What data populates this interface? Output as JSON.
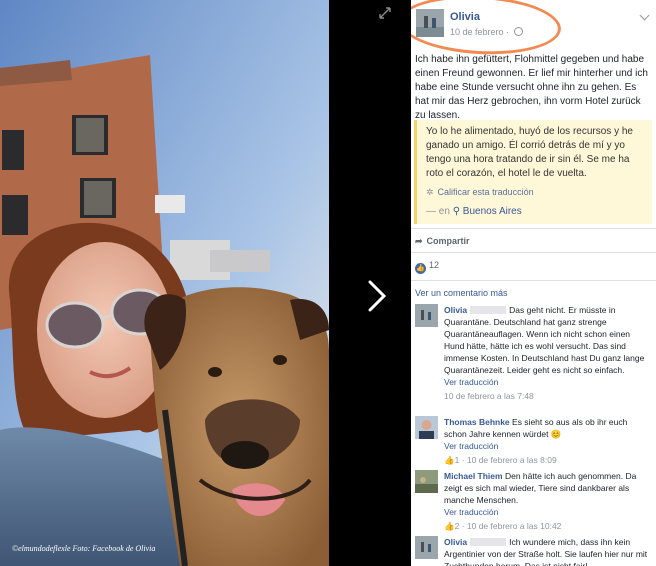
{
  "photo": {
    "watermark": "©elmundodeflexle Foto: Facebook de Olivia"
  },
  "navigation": {
    "next_icon": "chevron-right-icon",
    "expand_icon": "expand-arrows-icon"
  },
  "post": {
    "author": "Olivia",
    "date": "10 de febrero",
    "date_separator": " · ",
    "text": "Ich habe ihn gefüttert, Flohmittel gegeben und habe einen Freund gewonnen. Er lief mir hinterher und ich habe eine Stunde versucht ohne ihn zu gehen. Es hat mir das Herz gebrochen, ihn vorm Hotel zurück zu lassen.",
    "translation": "Yo lo he alimentado, huyó de los recursos y he ganado un amigo. Él corrió detrás de mí y yo tengo una hora tratando de ir sin él. Se me ha roto el corazón, el hotel le de vuelta.",
    "rate_translation": "Calificar esta traducción",
    "location_prefix": "— en",
    "location": "Buenos Aires",
    "share": "Compartir",
    "likes": "12",
    "accent_color": "#385898",
    "highlight_color": "#f28b53"
  },
  "comments": {
    "view_more": "Ver un comentario más",
    "items": [
      {
        "name": "Olivia",
        "text": "Das geht nicht. Er müsste in Quarantäne. Deutschland hat ganz strenge Quarantäneauflagen. Wenn ich nicht schon einen Hund hätte, hätte ich es wohl versucht. Das sind immense Kosten. In Deutschland hast Du ganz lange Quarantänezeit. Leider geht es nicht so einfach.",
        "see_translation": "Ver traducción",
        "time": "10 de febrero a las 7:48"
      },
      {
        "name": "Thomas Behnke",
        "text": "Es sieht so aus als ob ihr euch schon Jahre kennen würdet",
        "see_translation": "Ver traducción",
        "likes": "1",
        "time": "10 de febrero a las 8:09"
      },
      {
        "name": "Michael Thiem",
        "text": "Den hätte ich auch genommen. Da zeigt es sich mal wieder, Tiere sind dankbarer als manche Menschen.",
        "see_translation": "Ver traducción",
        "likes": "2",
        "time": "10 de febrero a las 10:42"
      },
      {
        "name": "Olivia",
        "text": "Ich wundere mich, dass ihn kein Argentinier von der Straße holt. Sie laufen hier nur mit Zuchthunden herum. Das ist nicht fair!"
      }
    ]
  }
}
